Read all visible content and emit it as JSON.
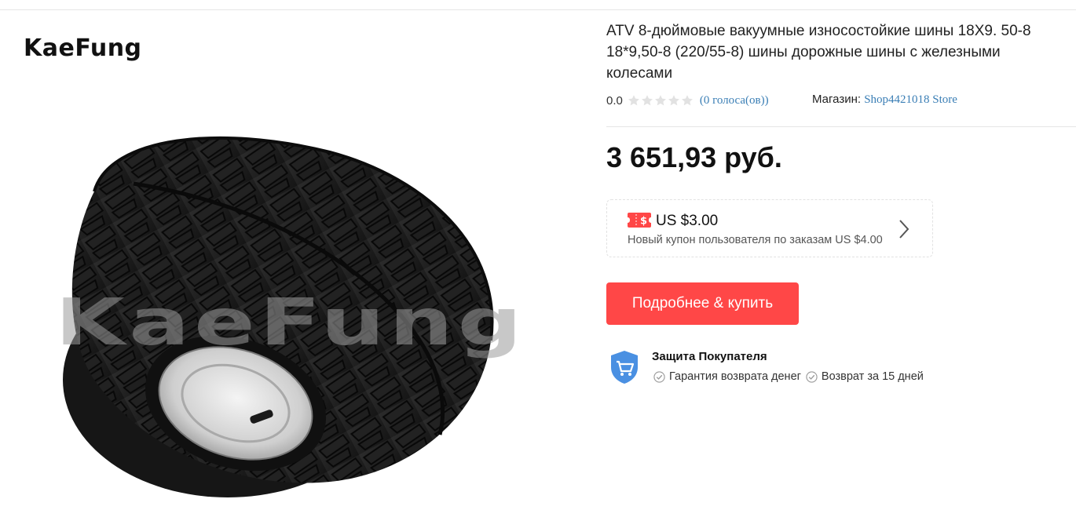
{
  "gallery": {
    "brand_logo": "KaeFung",
    "watermark": "KaeFung"
  },
  "product": {
    "title": "ATV 8-дюймовые вакуумные износостойкие шины 18X9. 50-8 18*9,50-8 (220/55-8) шины дорожные шины с железными колесами",
    "rating": "0.0",
    "stars_filled": 0,
    "stars_total": 5,
    "votes": "(0 голоса(ов))",
    "store_label": "Магазин:",
    "store_name": "Shop4421018 Store",
    "price": "3 651,93 руб."
  },
  "coupon": {
    "icon": "coupon-icon",
    "amount": "US $3.00",
    "description": "Новый купон пользователя по заказам US $4.00",
    "arrow_icon": "chevron-right-icon"
  },
  "buy_button": {
    "label": "Подробнее & купить"
  },
  "protection": {
    "icon": "shield-cart-icon",
    "title": "Защита Покупателя",
    "items": [
      "Гарантия возврата денег",
      "Возврат за 15 дней"
    ]
  },
  "colors": {
    "accent": "#ff4747",
    "link": "#3a7eb5",
    "shield": "#4a90e2"
  }
}
